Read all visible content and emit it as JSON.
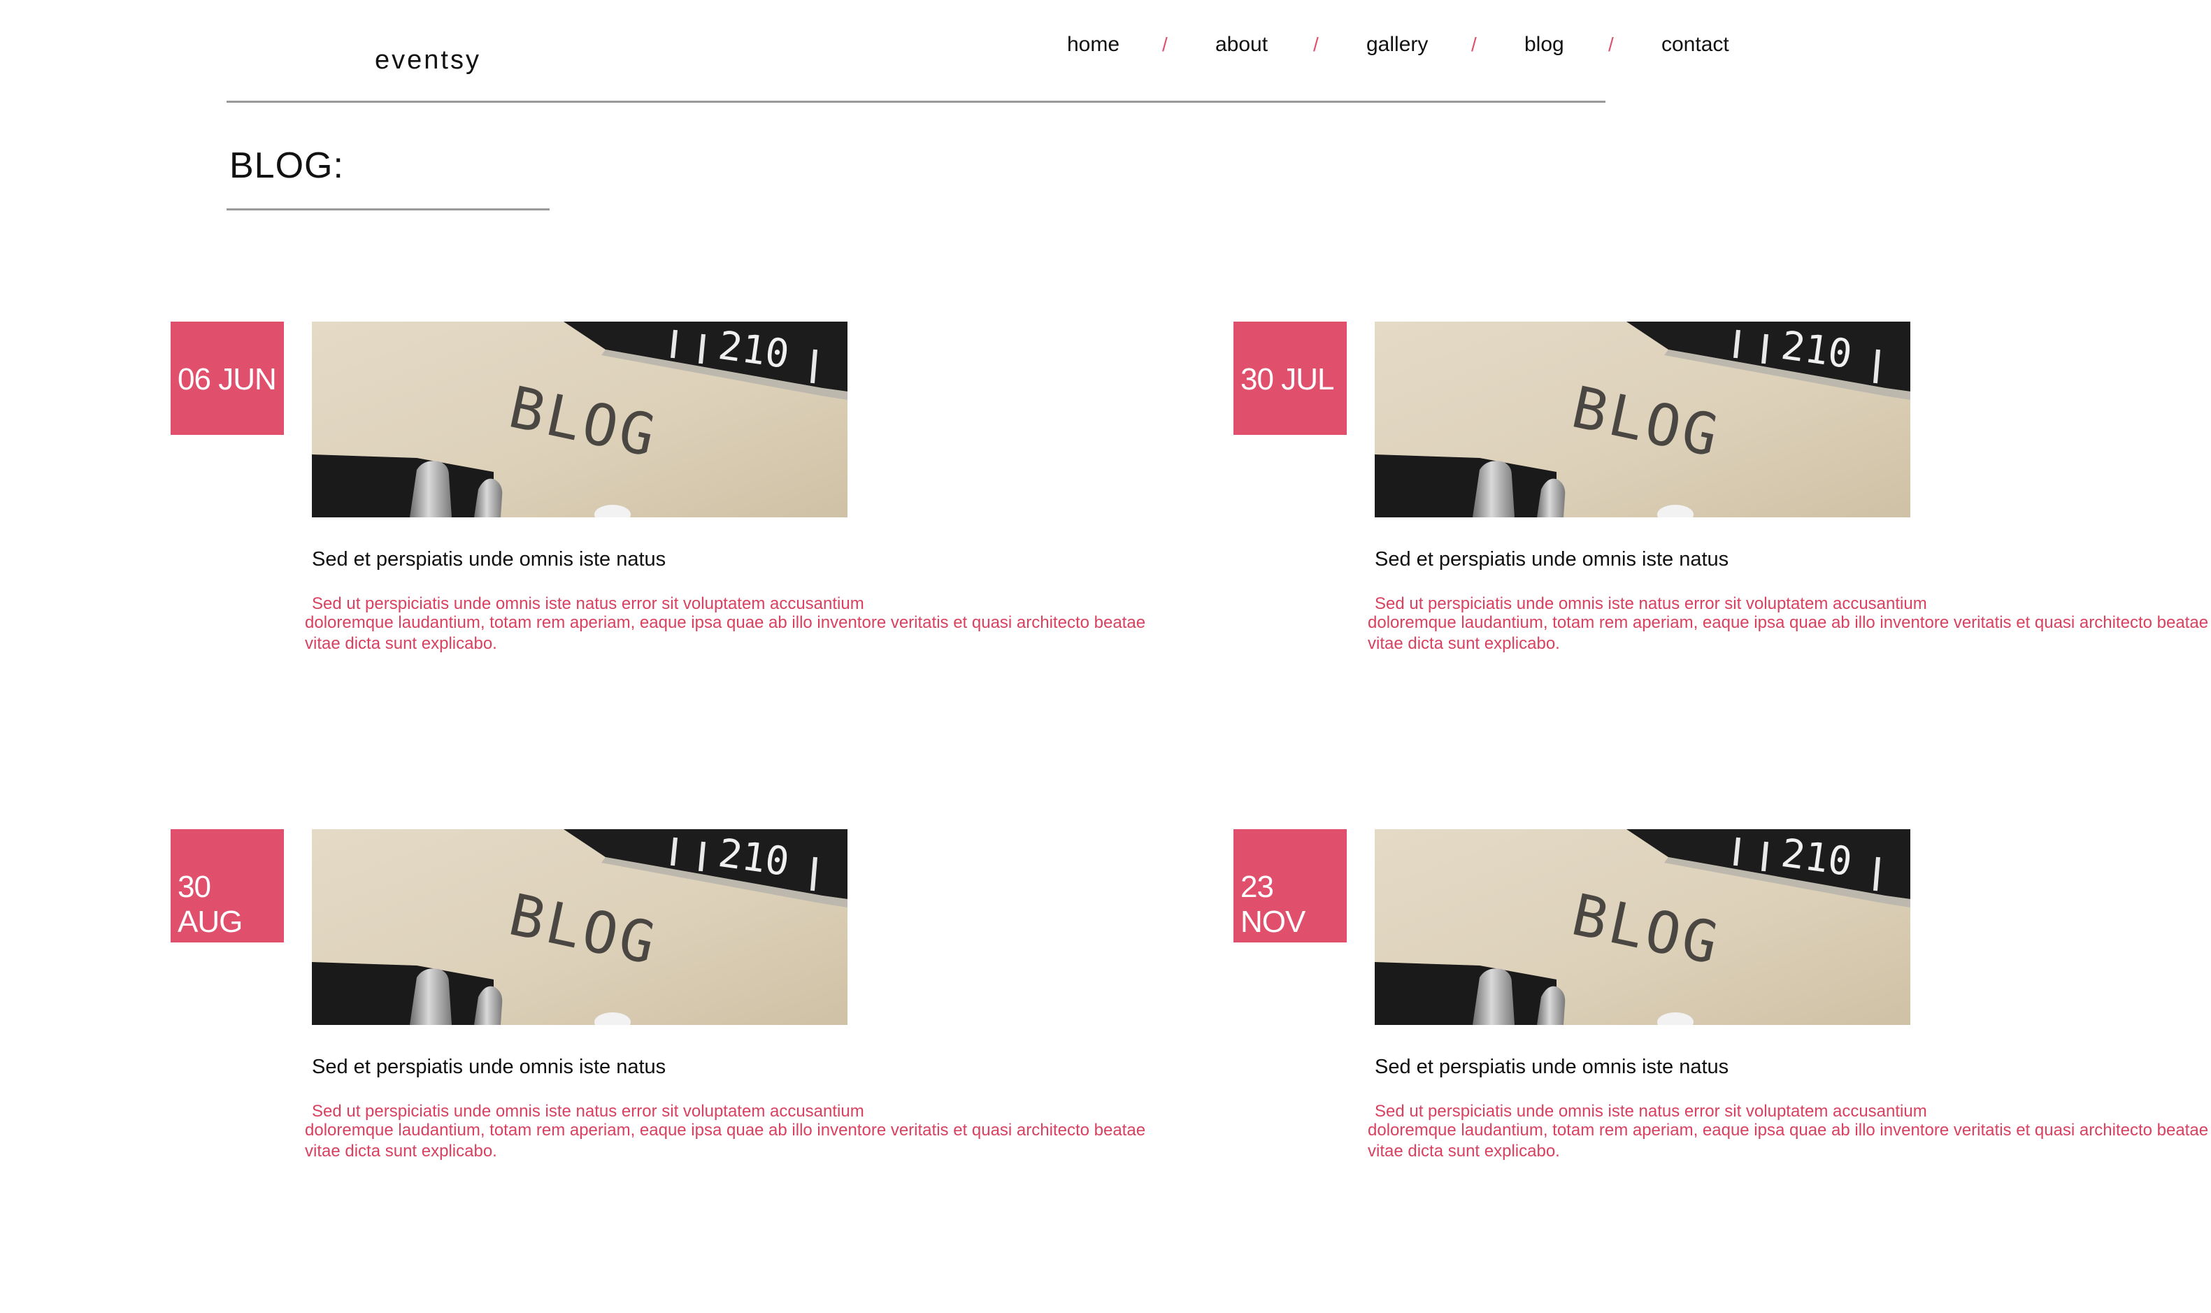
{
  "site": {
    "logo": "eventsy"
  },
  "nav": {
    "items": [
      "home",
      "about",
      "gallery",
      "blog",
      "contact"
    ],
    "separator": "/"
  },
  "page": {
    "title": "BLOG:"
  },
  "colors": {
    "accent": "#e0506d",
    "excerpt": "#d8415f",
    "divider": "#9a9a9a"
  },
  "posts": [
    {
      "day": "06",
      "month": "JUN",
      "thumbnail_text": "BLOG",
      "title": "Sed et perspiatis unde omnis iste natus",
      "excerpt_l1": "Sed ut perspiciatis unde omnis iste natus error sit voluptatem accusantium",
      "excerpt_l2": "doloremque laudantium, totam rem aperiam, eaque ipsa quae ab illo inventore veritatis et quasi architecto beatae",
      "excerpt_l3": "vitae dicta sunt explicabo."
    },
    {
      "day": "30",
      "month": "JUL",
      "thumbnail_text": "BLOG",
      "title": "Sed et perspiatis unde omnis iste natus",
      "excerpt_l1": "Sed ut perspiciatis unde omnis iste natus error sit voluptatem accusantium",
      "excerpt_l2": "doloremque laudantium, totam rem aperiam, eaque ipsa quae ab illo inventore veritatis et quasi architecto beatae",
      "excerpt_l3": "vitae dicta sunt explicabo."
    },
    {
      "day": "30",
      "month": "AUG",
      "thumbnail_text": "BLOG",
      "title": "Sed et perspiatis unde omnis iste natus",
      "excerpt_l1": "Sed ut perspiciatis unde omnis iste natus error sit voluptatem accusantium",
      "excerpt_l2": "doloremque laudantium, totam rem aperiam, eaque ipsa quae ab illo inventore veritatis et quasi architecto beatae",
      "excerpt_l3": "vitae dicta sunt explicabo."
    },
    {
      "day": "23",
      "month": "NOV",
      "thumbnail_text": "BLOG",
      "title": "Sed et perspiatis unde omnis iste natus",
      "excerpt_l1": "Sed ut perspiciatis unde omnis iste natus error sit voluptatem accusantium",
      "excerpt_l2": "doloremque laudantium, totam rem aperiam, eaque ipsa quae ab illo inventore veritatis et quasi architecto beatae",
      "excerpt_l3": "vitae dicta sunt explicabo."
    }
  ]
}
